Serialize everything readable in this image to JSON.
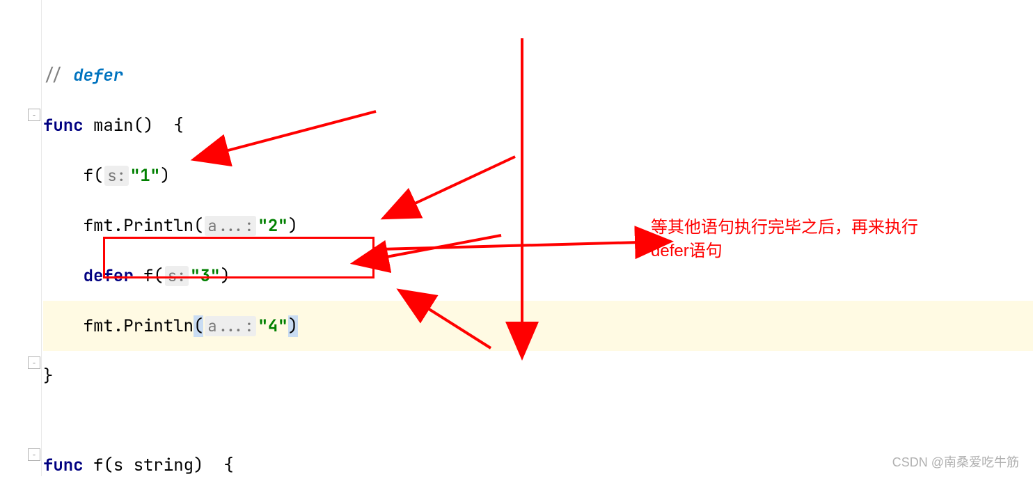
{
  "code": {
    "comment_prefix": "// ",
    "comment_word": "defer",
    "func_kw": "func",
    "main_name": " main()  {",
    "f_open": "f(",
    "hint_s": "s:",
    "str1": "\"1\"",
    "close_paren": ")",
    "println_prefix": "fmt.Println(",
    "hint_a": "a...:",
    "str2": "\"2\"",
    "defer_kw": "defer",
    "f_call2": " f(",
    "str3": "\"3\"",
    "str4": "\"4\"",
    "close_brace": "}",
    "func_f": " f(s string)  {"
  },
  "annotation": {
    "text1": "等其他语句执行完毕之后，再来执行",
    "text2": "defer语句"
  },
  "watermark": "CSDN @南桑爱吃牛筋"
}
